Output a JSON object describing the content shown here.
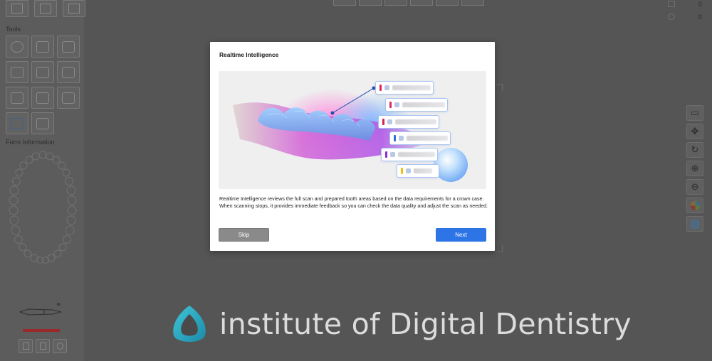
{
  "app": {
    "left_panel": {
      "tools_label": "Tools",
      "form_info_label": "Form Information"
    },
    "counters": [
      "0",
      "0"
    ]
  },
  "modal": {
    "title": "Realtime Intelligence",
    "description": "Realtime Intelligence reviews the full scan and prepared tooth areas based on the data requirements for a crown case. When scanning stops, it provides immediate feedback so you can check the data quality and adjust the scan as needed.",
    "skip_label": "Skip",
    "next_label": "Next",
    "label_chip_colors": [
      "#e0245e",
      "#d62d6a",
      "#d6244f",
      "#2f6fd6",
      "#8a2bd6",
      "#f2c200"
    ]
  },
  "watermark": {
    "text": "institute of Digital Dentistry"
  },
  "colors": {
    "accent_next": "#2d74e6",
    "skip_gray": "#8a8a8a",
    "overlay_bg": "#555555"
  }
}
